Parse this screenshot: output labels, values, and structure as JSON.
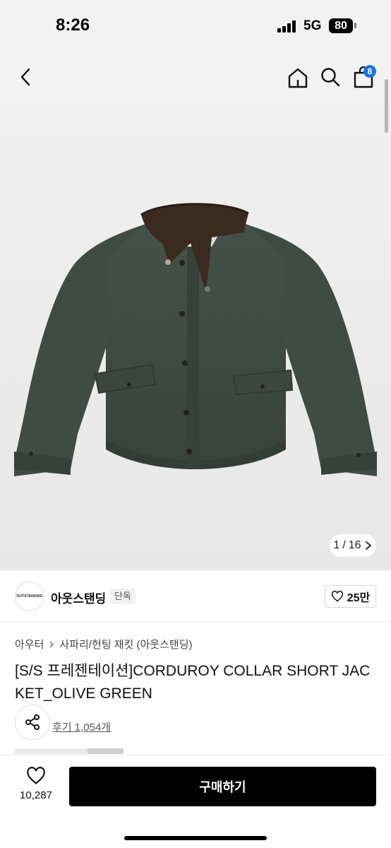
{
  "status_bar": {
    "time": "8:26",
    "network": "5G",
    "battery": "80",
    "signal_bars": 4
  },
  "nav": {
    "back_icon": "chevron-left-icon",
    "home_icon": "home-icon",
    "search_icon": "search-icon",
    "bag_icon": "shopping-bag-icon",
    "cart_count": "8"
  },
  "gallery": {
    "current": "1",
    "separator": "/",
    "total": "16"
  },
  "brand": {
    "logo_text": "OUTSTANDING",
    "name": "아웃스탠딩",
    "badge": "단독",
    "likes": "25만"
  },
  "product": {
    "breadcrumb": [
      "아우터",
      "사파리/헌팅 재킷 (아웃스탠딩)"
    ],
    "title": "[S/S 프레젠테이션]CORDUROY COLLAR SHORT JACKET_OLIVE GREEN",
    "review_link": "후기 1,054개"
  },
  "bottom": {
    "wish_count": "10,287",
    "buy_label": "구매하기"
  },
  "colors": {
    "badge_blue": "#1a73e8",
    "jacket_olive": "#3d4a42",
    "collar_brown": "#3b2a1f",
    "buy_button": "#000000"
  }
}
